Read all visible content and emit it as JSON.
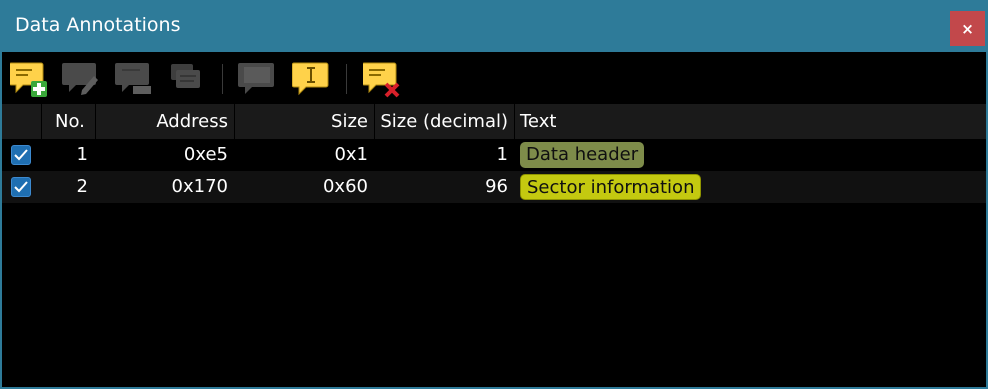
{
  "window": {
    "title": "Data Annotations",
    "close_label": "×"
  },
  "toolbar": {
    "buttons": [
      {
        "icon": "add-annotation-icon",
        "enabled": true
      },
      {
        "icon": "edit-annotation-icon",
        "enabled": false
      },
      {
        "icon": "annotation-properties-icon",
        "enabled": false
      },
      {
        "icon": "copy-annotation-icon",
        "enabled": false
      },
      {
        "icon": "comment-icon",
        "enabled": false
      },
      {
        "icon": "rename-annotation-icon",
        "enabled": true
      },
      {
        "icon": "delete-annotation-icon",
        "enabled": true
      }
    ]
  },
  "table": {
    "columns": [
      "",
      "No.",
      "Address",
      "Size",
      "Size (decimal)",
      "Text"
    ],
    "rows": [
      {
        "checked": true,
        "no": "1",
        "address": "0xe5",
        "size": "0x1",
        "size_decimal": "1",
        "text": "Data header",
        "color": "#7e8c4a"
      },
      {
        "checked": true,
        "no": "2",
        "address": "0x170",
        "size": "0x60",
        "size_decimal": "96",
        "text": "Sector information",
        "color": "#c4c910"
      }
    ]
  },
  "colors": {
    "titlebar": "#2e7b99",
    "close_button": "#c2484b",
    "checkbox": "#1f6fb2",
    "icon_yellow": "#ffd24a"
  }
}
